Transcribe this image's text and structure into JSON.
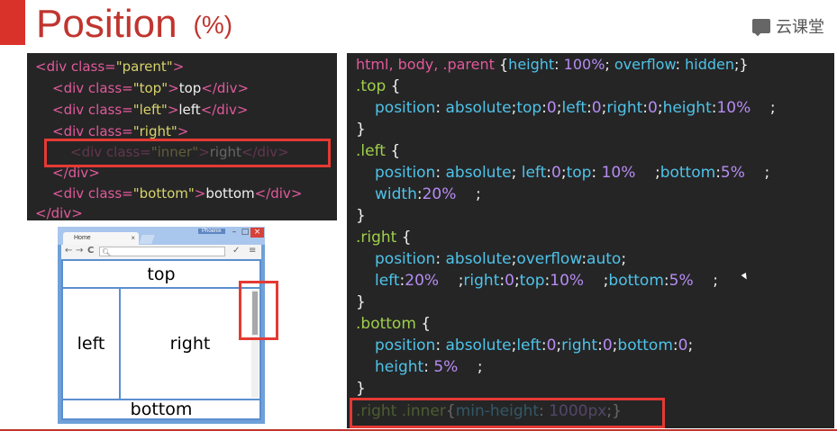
{
  "header": {
    "title": "Position",
    "unit": "(%)",
    "brand_name": "云课堂",
    "brand_icon": "chat-bubble-icon"
  },
  "html_code": {
    "l1_open": "<div class=",
    "l1_str": "\"parent\"",
    "l1_close": ">",
    "l2_open": "<div class=",
    "l2_str": "\"top\"",
    "l2_gt": ">",
    "l2_text": "top",
    "l2_end": "</div>",
    "l3_open": "<div class=",
    "l3_str": "\"left\"",
    "l3_gt": ">",
    "l3_text": "left",
    "l3_end": "</div>",
    "l4_open": "<div class=",
    "l4_str": "\"right\"",
    "l4_gt": ">",
    "l5_open": "<div class=",
    "l5_str": "\"inner\"",
    "l5_gt": ">",
    "l5_text": "right",
    "l5_end": "</div>",
    "l6_end": "</div>",
    "l7_open": "<div class=",
    "l7_str": "\"bottom\"",
    "l7_gt": ">",
    "l7_text": "bottom",
    "l7_end": "</div>",
    "l8_end": "</div>"
  },
  "css_code": {
    "l1_sel": "html, body, .parent ",
    "l1_brace": "{",
    "l1_p1": "height",
    "l1_c1": ": ",
    "l1_v1": "100%",
    "l1_sc1": "; ",
    "l1_p2": "overflow",
    "l1_c2": ": ",
    "l1_v2": "hidden",
    "l1_end": ";}",
    "l2_sel": ".top ",
    "l2_brace": "{",
    "l3_p1": "position",
    "l3_c1": ": ",
    "l3_v1": "absolute",
    "l3_s1": ";",
    "l3_p2": "top",
    "l3_c2": ":",
    "l3_v2": "0",
    "l3_s2": ";",
    "l3_p3": "left",
    "l3_c3": ":",
    "l3_v3": "0",
    "l3_s3": ";",
    "l3_p4": "right",
    "l3_c4": ":",
    "l3_v4": "0",
    "l3_s4": ";",
    "l3_p5": "height",
    "l3_c5": ":",
    "l3_v5": "10%",
    "l3_end": "    ;",
    "l4_close": "}",
    "l5_sel": ".left ",
    "l5_brace": "{",
    "l6_p1": "position",
    "l6_c1": ": ",
    "l6_v1": "absolute",
    "l6_s1": "; ",
    "l6_p2": "left",
    "l6_c2": ":",
    "l6_v2": "0",
    "l6_s2": ";",
    "l6_p3": "top",
    "l6_c3": ": ",
    "l6_v3": "10%",
    "l6_s3": "    ;",
    "l6_p4": "bottom",
    "l6_c4": ":",
    "l6_v4": "5%",
    "l6_end": "    ;",
    "l7_p1": "width",
    "l7_c1": ":",
    "l7_v1": "20%",
    "l7_end": "    ;",
    "l8_close": "}",
    "l9_sel": ".right ",
    "l9_brace": "{",
    "l10_p1": "position",
    "l10_c1": ": ",
    "l10_v1": "absolute",
    "l10_s1": ";",
    "l10_p2": "overflow",
    "l10_c2": ":",
    "l10_v2": "auto",
    "l10_end": ";",
    "l11_p1": "left",
    "l11_c1": ":",
    "l11_v1": "20%",
    "l11_s1": "    ;",
    "l11_p2": "right",
    "l11_c2": ":",
    "l11_v2": "0",
    "l11_s2": ";",
    "l11_p3": "top",
    "l11_c3": ":",
    "l11_v3": "10%",
    "l11_s3": "    ;",
    "l11_p4": "bottom",
    "l11_c4": ":",
    "l11_v4": "5%",
    "l11_end": "    ;",
    "l12_close": "}",
    "l13_sel": ".bottom ",
    "l13_brace": "{",
    "l14_p1": "position",
    "l14_c1": ": ",
    "l14_v1": "absolute",
    "l14_s1": ";",
    "l14_p2": "left",
    "l14_c2": ":",
    "l14_v2": "0",
    "l14_s2": ";",
    "l14_p3": "right",
    "l14_c3": ":",
    "l14_v3": "0",
    "l14_s3": ";",
    "l14_p4": "bottom",
    "l14_c4": ":",
    "l14_v4": "0",
    "l14_end": ";",
    "l15_p1": "height",
    "l15_c1": ": ",
    "l15_v1": "5%",
    "l15_end": "    ;",
    "l16_close": "}",
    "l17_sel": ".right .inner",
    "l17_brace": "{",
    "l17_p1": "min-height",
    "l17_c1": ": ",
    "l17_v1": "1000px",
    "l17_end": ";}"
  },
  "browser": {
    "tab_label": "Home",
    "tab_close": "×",
    "window_label": "Phoenix",
    "min_glyph": "–",
    "max_glyph": "□",
    "close_glyph": "×",
    "back_glyph": "←",
    "forward_glyph": "→",
    "reload_glyph": "C",
    "url_icon": "search-icon",
    "url_glyph": "🔍︎",
    "menu_glyph": "≡",
    "tools_glyph": "✓",
    "panes": {
      "top": "top",
      "left": "left",
      "right": "right",
      "bottom": "bottom"
    }
  },
  "colors": {
    "accent": "#d9322a",
    "highlight": "#e43a33",
    "code_bg": "#252526",
    "browser_frame": "#6fa0d8"
  }
}
